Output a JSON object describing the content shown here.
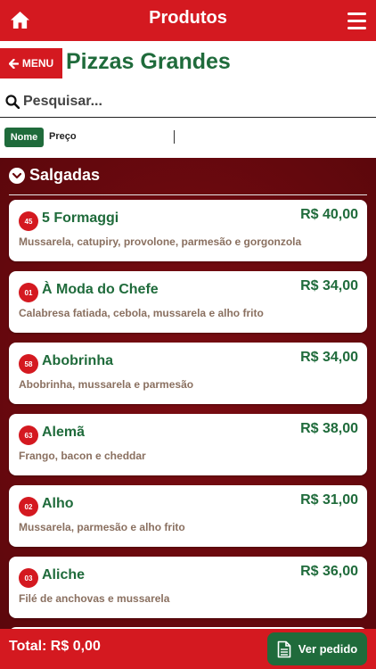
{
  "header": {
    "title": "Produtos",
    "home_icon": "home-icon",
    "menu_icon": "hamburger-menu-icon"
  },
  "titlebar": {
    "menu_label": "MENU",
    "back_icon": "arrow-left-icon",
    "title": "Pizzas Grandes"
  },
  "search": {
    "placeholder": "Pesquisar...",
    "value": "",
    "icon": "search-icon"
  },
  "sort": {
    "nome_label": "Nome",
    "preco_label": "Preço",
    "selected": "Nome"
  },
  "section": {
    "label": "Salgadas",
    "icon": "chevron-down-circle-icon"
  },
  "products": [
    {
      "code": "45",
      "name": "5 Formaggi",
      "price": "R$ 40,00",
      "description": "Mussarela, catupiry, provolone, parmesão e gorgonzola"
    },
    {
      "code": "01",
      "name": "À Moda do Chefe",
      "price": "R$ 34,00",
      "description": "Calabresa fatiada, cebola, mussarela e alho frito"
    },
    {
      "code": "58",
      "name": "Abobrinha",
      "price": "R$ 34,00",
      "description": "Abobrinha, mussarela e parmesão"
    },
    {
      "code": "63",
      "name": "Alemã",
      "price": "R$ 38,00",
      "description": "Frango, bacon e cheddar"
    },
    {
      "code": "02",
      "name": "Alho",
      "price": "R$ 31,00",
      "description": "Mussarela, parmesão e alho frito"
    },
    {
      "code": "03",
      "name": "Aliche",
      "price": "R$ 36,00",
      "description": "Filé de anchovas e mussarela"
    }
  ],
  "footer": {
    "total_label": "Total: R$ 0,00",
    "ver_pedido_label": "Ver pedido",
    "ver_pedido_icon": "document-icon"
  },
  "colors": {
    "brand_red": "#d41920",
    "brand_green": "#1f6b3b",
    "background_dark_red": "#6a090e",
    "description_text": "#8a7060"
  }
}
